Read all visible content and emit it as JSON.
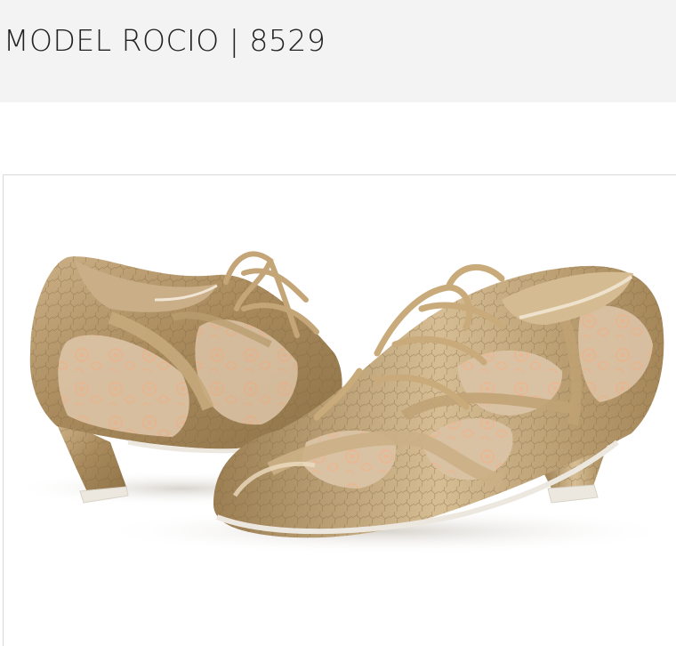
{
  "header": {
    "title": "MODEL ROCIO | 8529",
    "background": "#f3f3f3"
  },
  "product_image": {
    "subject": "pair of gold crackle-leather lace-up dance shoes with floral mesh panels",
    "colors": {
      "gold": "#b89a6a",
      "gold_light": "#d9c29a",
      "mesh": "#d8bfa2",
      "flower": "#e8c7a8",
      "sole": "#ece8e0"
    }
  }
}
